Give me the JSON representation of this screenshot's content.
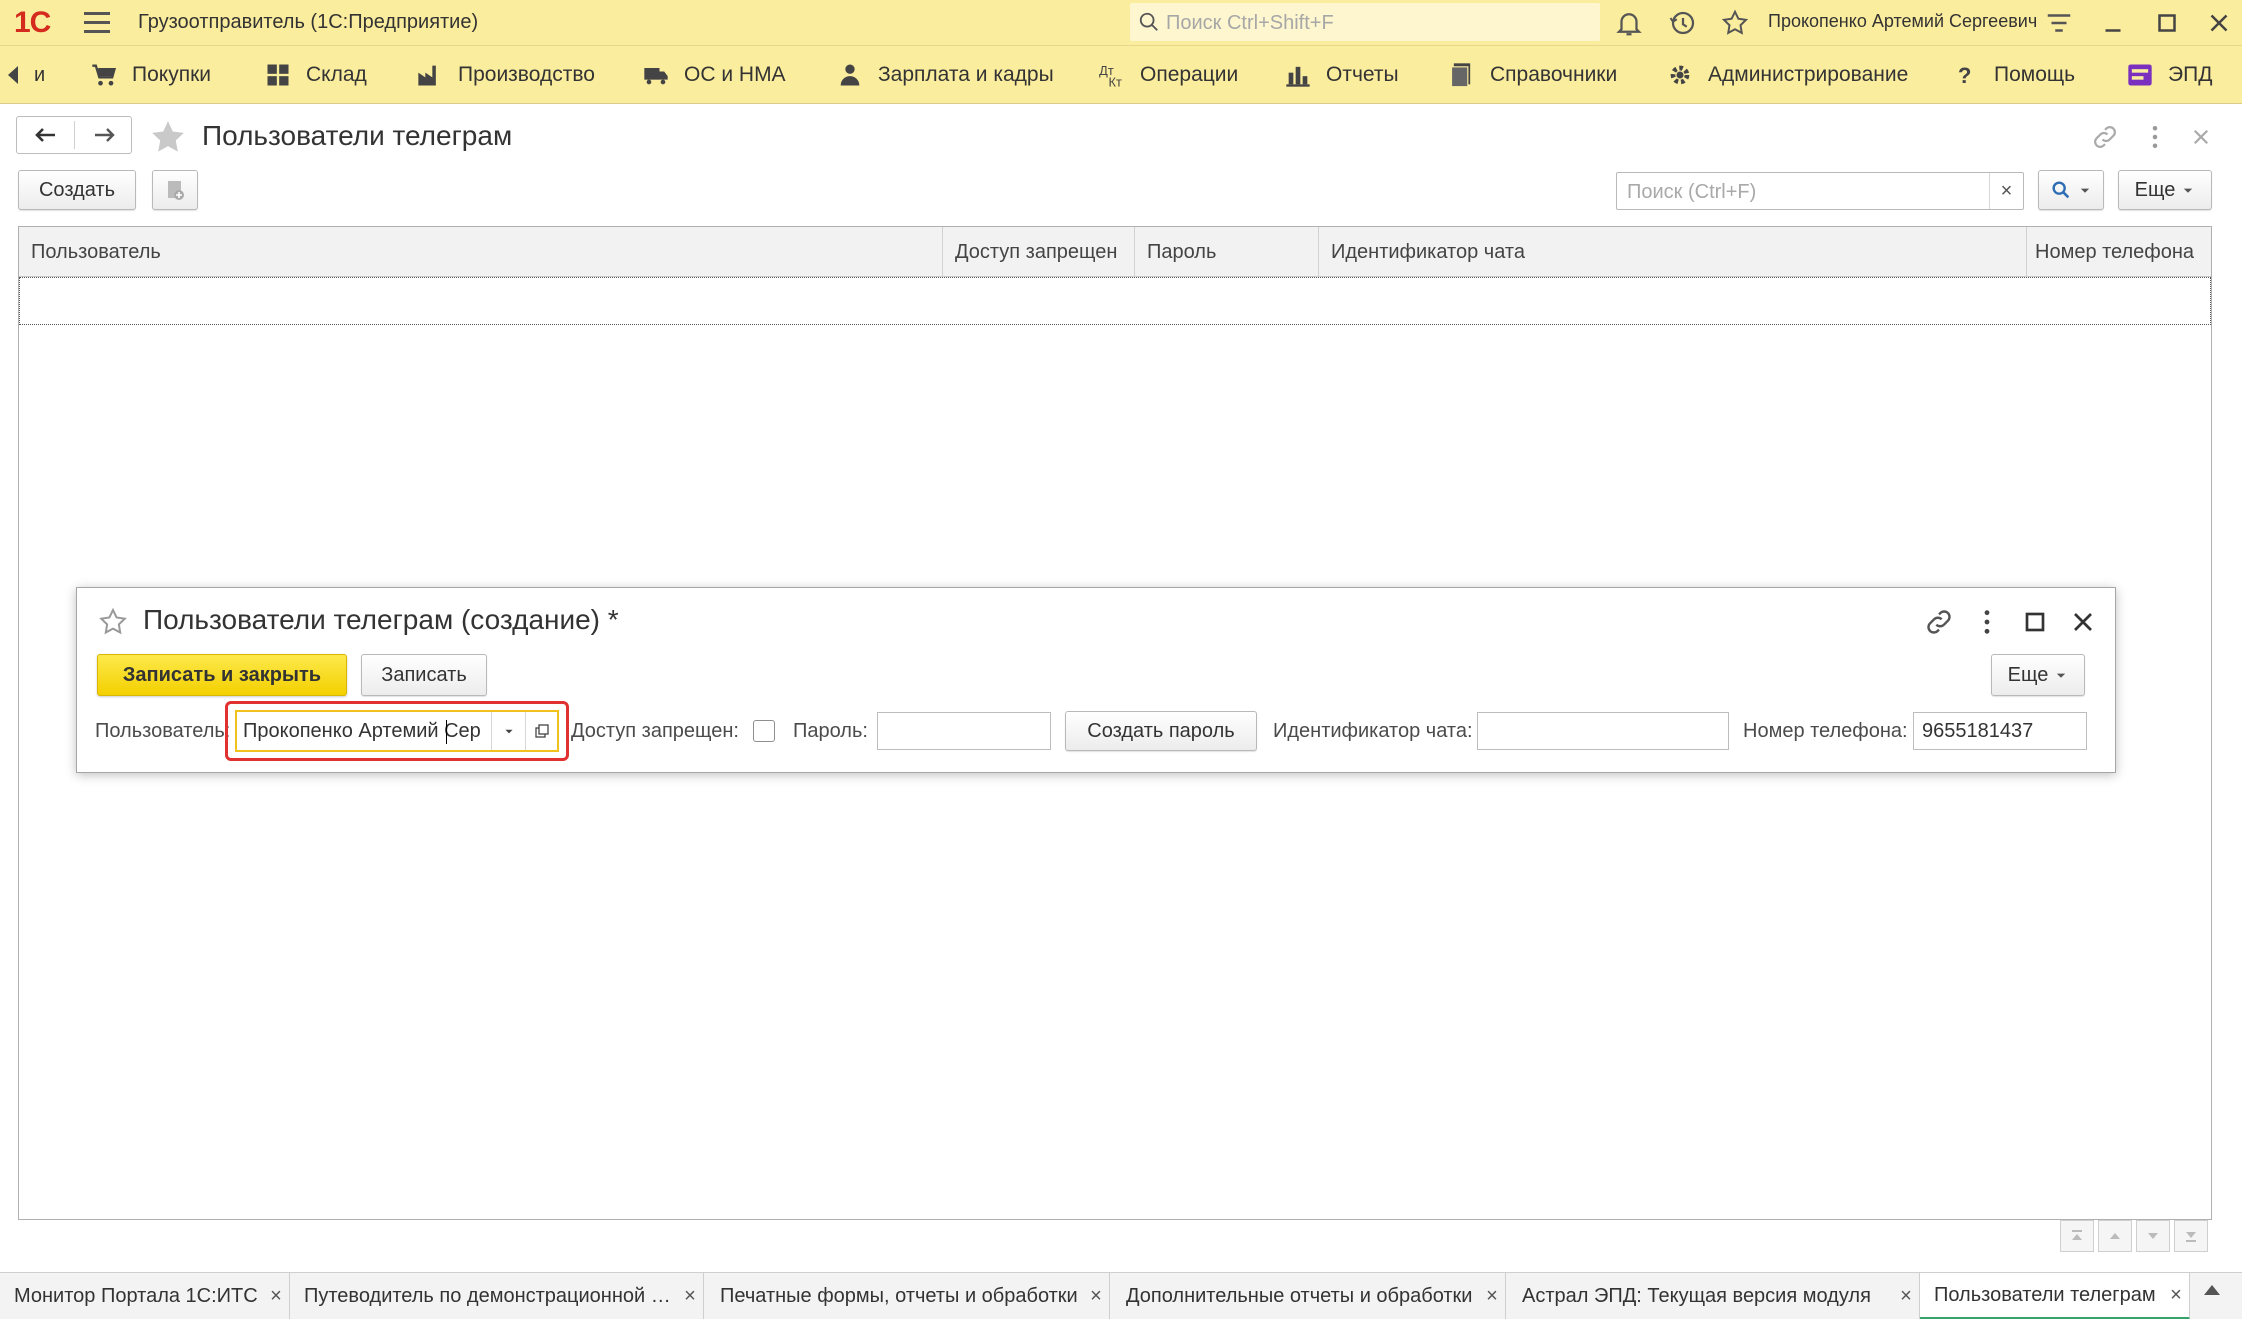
{
  "app": {
    "title": "Грузоотправитель  (1С:Предприятие)",
    "search_placeholder": "Поиск Ctrl+Shift+F",
    "user_name": "Прокопенко Артемий Сергеевич"
  },
  "sections": {
    "partial_label": "и",
    "items": [
      {
        "label": "Покупки",
        "icon": "cart-icon"
      },
      {
        "label": "Склад",
        "icon": "warehouse-icon"
      },
      {
        "label": "Производство",
        "icon": "factory-icon"
      },
      {
        "label": "ОС и НМА",
        "icon": "truck-icon"
      },
      {
        "label": "Зарплата и кадры",
        "icon": "person-icon"
      },
      {
        "label": "Операции",
        "icon": "operations-icon"
      },
      {
        "label": "Отчеты",
        "icon": "bar-chart-icon"
      },
      {
        "label": "Справочники",
        "icon": "books-icon"
      },
      {
        "label": "Администрирование",
        "icon": "gear-icon"
      },
      {
        "label": "Помощь",
        "icon": "question-icon"
      },
      {
        "label": "ЭПД",
        "icon": "epd-icon"
      }
    ]
  },
  "list_form": {
    "title": "Пользователи телеграм",
    "create_label": "Создать",
    "search_placeholder": "Поиск (Ctrl+F)",
    "clear_glyph": "×",
    "more_label": "Еще",
    "columns": [
      "Пользователь",
      "Доступ запрещен",
      "Пароль",
      "Идентификатор чата",
      "Номер телефона"
    ]
  },
  "sub_form": {
    "title": "Пользователи телеграм (создание) *",
    "save_close_label": "Записать и закрыть",
    "save_label": "Записать",
    "more_label": "Еще",
    "user_label": "Пользователь:",
    "user_value": "Прокопенко Артемий Сер",
    "access_denied_label": "Доступ запрещен:",
    "access_denied_checked": false,
    "password_label": "Пароль:",
    "password_value": "",
    "create_password_label": "Создать пароль",
    "chat_id_label": "Идентификатор чата:",
    "chat_id_value": "",
    "phone_label": "Номер телефона:",
    "phone_value": "9655181437"
  },
  "tabs": [
    {
      "label": "Монитор Портала 1С:ИТС"
    },
    {
      "label": "Путеводитель по демонстрационной базе"
    },
    {
      "label": "Печатные формы, отчеты и обработки"
    },
    {
      "label": "Дополнительные отчеты и обработки"
    },
    {
      "label": "Астрал ЭПД: Текущая версия модуля"
    },
    {
      "label": "Пользователи телеграм",
      "active": true
    }
  ],
  "colors": {
    "title_bar": "#fbed9e",
    "primary_button": "#f3d000",
    "highlight": "#e03030",
    "active_tab_accent": "#37a36b",
    "logo": "#d52b1e"
  }
}
